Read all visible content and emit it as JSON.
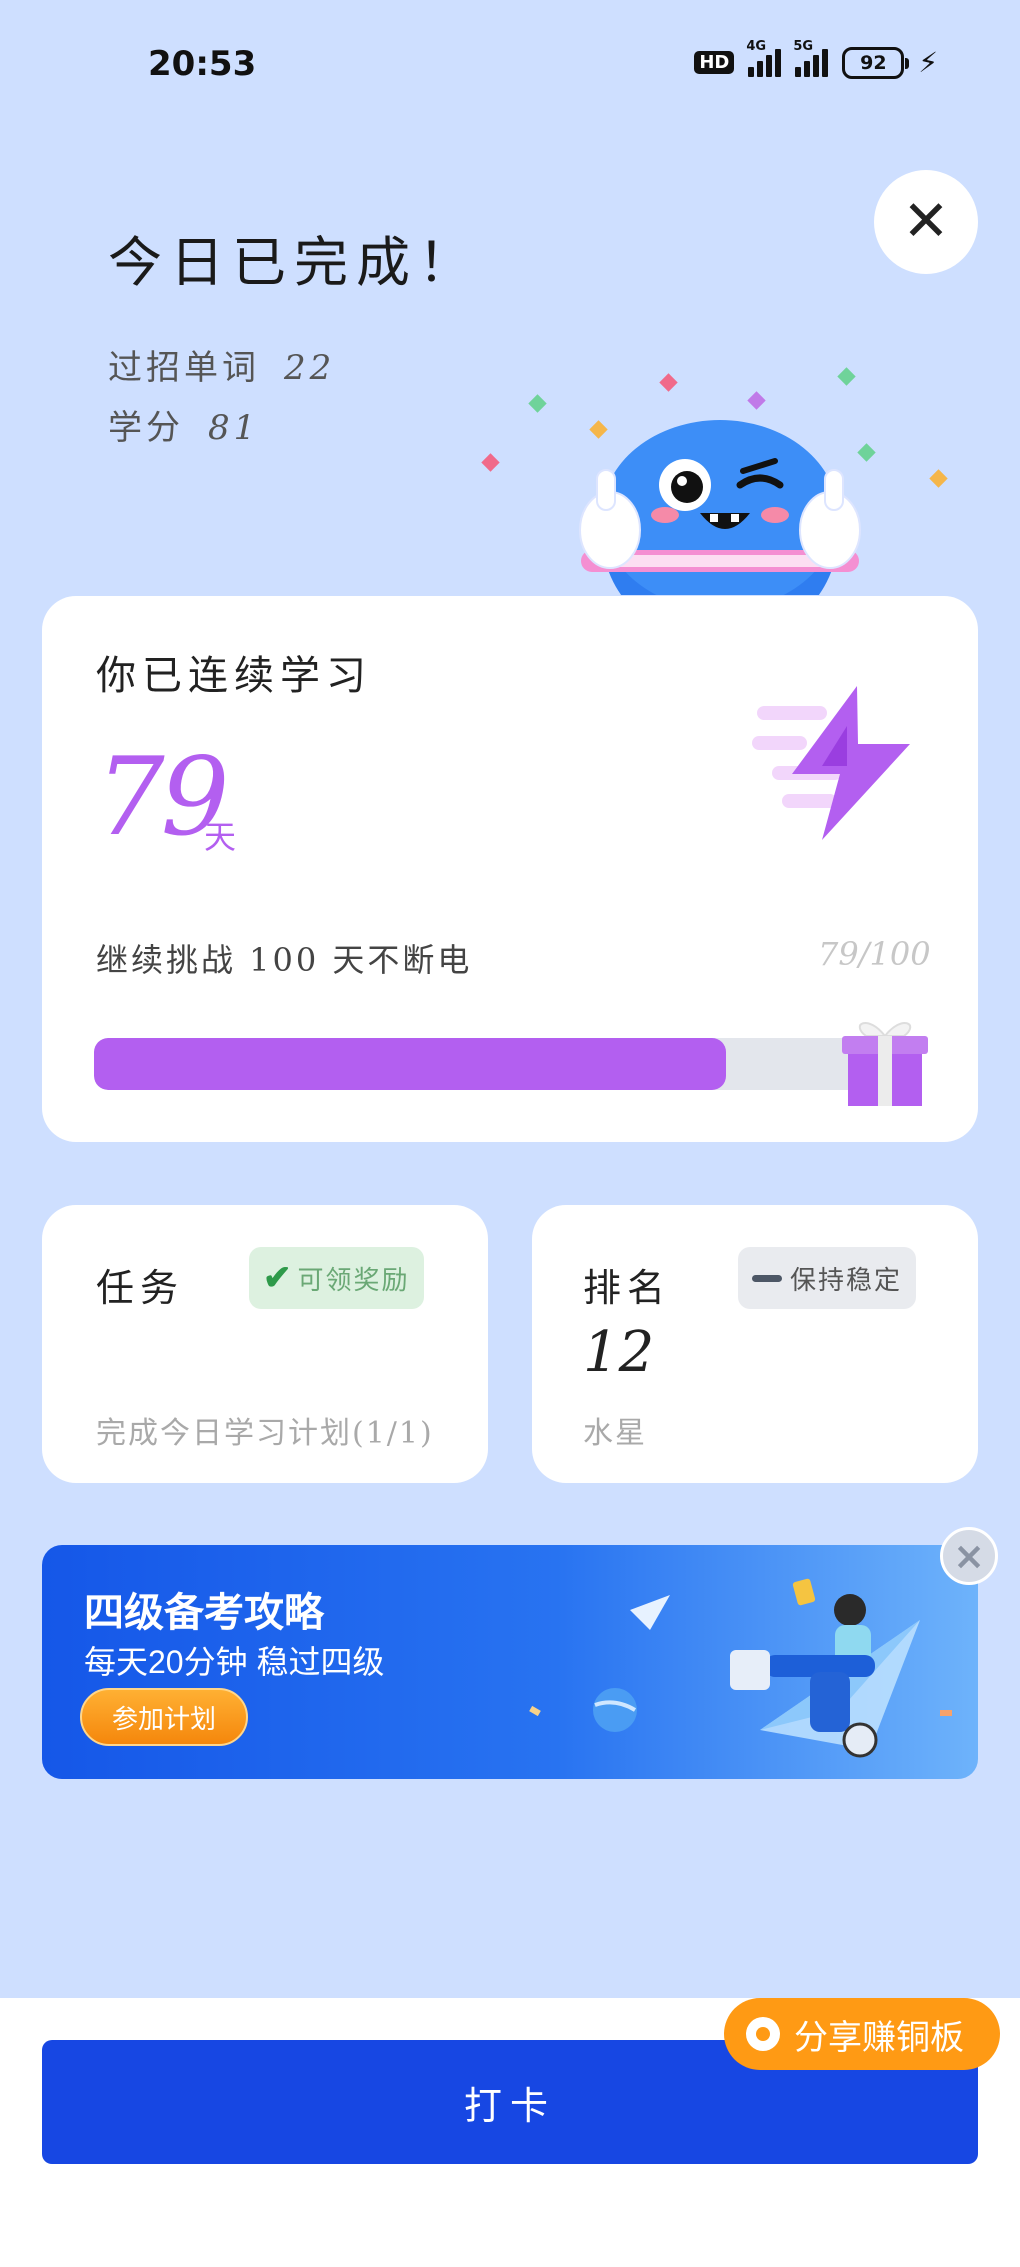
{
  "status_bar": {
    "time": "20:53",
    "hd": "HD",
    "net1": "4G",
    "net2": "5G",
    "battery": "92"
  },
  "header": {
    "title": "今日已完成！",
    "words_label": "过招单词",
    "words_value": "22",
    "credits_label": "学分",
    "credits_value": "81"
  },
  "streak": {
    "title": "你已连续学习",
    "days": "79",
    "unit": "天",
    "challenge": "继续挑战 100 天不断电",
    "count": "79/100",
    "progress": 0.79
  },
  "task_card": {
    "title": "任务",
    "badge": "可领奖励",
    "subtitle": "完成今日学习计划(1/1)"
  },
  "rank_card": {
    "title": "排名",
    "badge": "保持稳定",
    "rank": "12",
    "planet": "水星"
  },
  "banner": {
    "title": "四级备考攻略",
    "subtitle": "每天20分钟 稳过四级",
    "button": "参加计划"
  },
  "bottom": {
    "checkin": "打卡",
    "share": "分享赚铜板"
  },
  "colors": {
    "background": "#cedfff",
    "accent_purple": "#b35ff0",
    "primary_blue": "#1747e3",
    "share_orange": "#ff9a14"
  },
  "icons": [
    "close-icon",
    "check-icon",
    "dash-icon",
    "lightning-icon",
    "gift-icon",
    "mascot-icon",
    "share-icon"
  ]
}
